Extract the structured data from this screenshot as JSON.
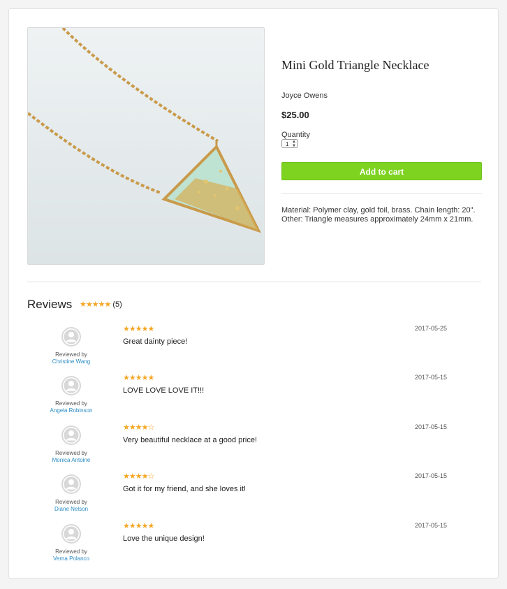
{
  "product": {
    "title": "Mini Gold Triangle Necklace",
    "seller": "Joyce Owens",
    "price": "$25.00",
    "quantity_label": "Quantity",
    "quantity_value": "1",
    "add_to_cart": "Add to cart",
    "description_line1": "Material: Polymer clay, gold foil, brass. Chain length: 20\".",
    "description_line2": "Other: Triangle measures approximately 24mm x 21mm."
  },
  "reviews": {
    "heading": "Reviews",
    "summary_stars": "★★★★★",
    "summary_rating": 4.6,
    "count": "(5)",
    "items": [
      {
        "by": "Reviewed by",
        "name": "Christine Wang",
        "stars": "★★★★★",
        "rating": 5,
        "text": "Great dainty piece!",
        "date": "2017-05-25"
      },
      {
        "by": "Reviewed by",
        "name": "Angela Robinson",
        "stars": "★★★★★",
        "rating": 5,
        "text": "LOVE LOVE LOVE IT!!!",
        "date": "2017-05-15"
      },
      {
        "by": "Reviewed by",
        "name": "Monica Antoine",
        "stars": "★★★★☆",
        "rating": 4,
        "text": "Very beautiful necklace at a good price!",
        "date": "2017-05-15"
      },
      {
        "by": "Reviewed by",
        "name": "Diane Nelson",
        "stars": "★★★★☆",
        "rating": 4,
        "text": "Got it for my friend, and she loves it!",
        "date": "2017-05-15"
      },
      {
        "by": "Reviewed by",
        "name": "Verna Polanco",
        "stars": "★★★★★",
        "rating": 5,
        "text": "Love the unique design!",
        "date": "2017-05-15"
      }
    ]
  },
  "colors": {
    "accent_green": "#7ed321",
    "star_gold": "#f5a623",
    "link_blue": "#2a8bc4"
  },
  "icons": {
    "avatar": "user-silhouette-icon",
    "star": "star-icon"
  }
}
